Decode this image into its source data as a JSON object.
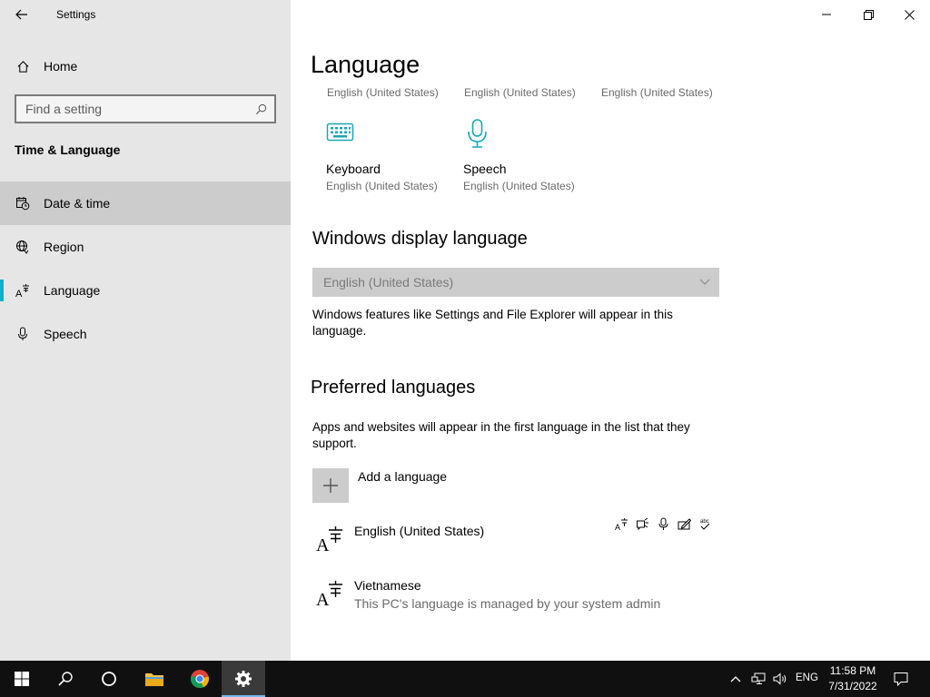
{
  "window": {
    "title": "Settings"
  },
  "sidebar": {
    "home_label": "Home",
    "search_placeholder": "Find a setting",
    "section_title": "Time & Language",
    "items": [
      {
        "label": "Date & time",
        "icon": "date-time-icon"
      },
      {
        "label": "Region",
        "icon": "globe-icon"
      },
      {
        "label": "Language",
        "icon": "language-icon"
      },
      {
        "label": "Speech",
        "icon": "microphone-icon"
      }
    ]
  },
  "main": {
    "title": "Language",
    "top_subs": [
      "English (United States)",
      "English (United States)",
      "English (United States)"
    ],
    "features": [
      {
        "name": "Keyboard",
        "desc": "English (United States)",
        "icon": "keyboard-icon"
      },
      {
        "name": "Speech",
        "desc": "English (United States)",
        "icon": "microphone-icon"
      }
    ],
    "display_language": {
      "heading": "Windows display language",
      "selected": "English (United States)",
      "description": "Windows features like Settings and File Explorer will appear in this language."
    },
    "preferred": {
      "heading": "Preferred languages",
      "description": "Apps and websites will appear in the first language in the list that they support.",
      "add_label": "Add a language",
      "languages": [
        {
          "name": "English (United States)",
          "desc": ""
        },
        {
          "name": "Vietnamese",
          "desc": "This PC's language is managed by your system admin"
        }
      ]
    }
  },
  "taskbar": {
    "time": "11:58 PM",
    "date": "7/31/2022",
    "lang": "ENG"
  },
  "colors": {
    "accent": "#0fb0c8",
    "sidebar_bg": "#e6e6e6",
    "selected_bg": "#cccccc",
    "taskbar_bg": "#101010"
  }
}
